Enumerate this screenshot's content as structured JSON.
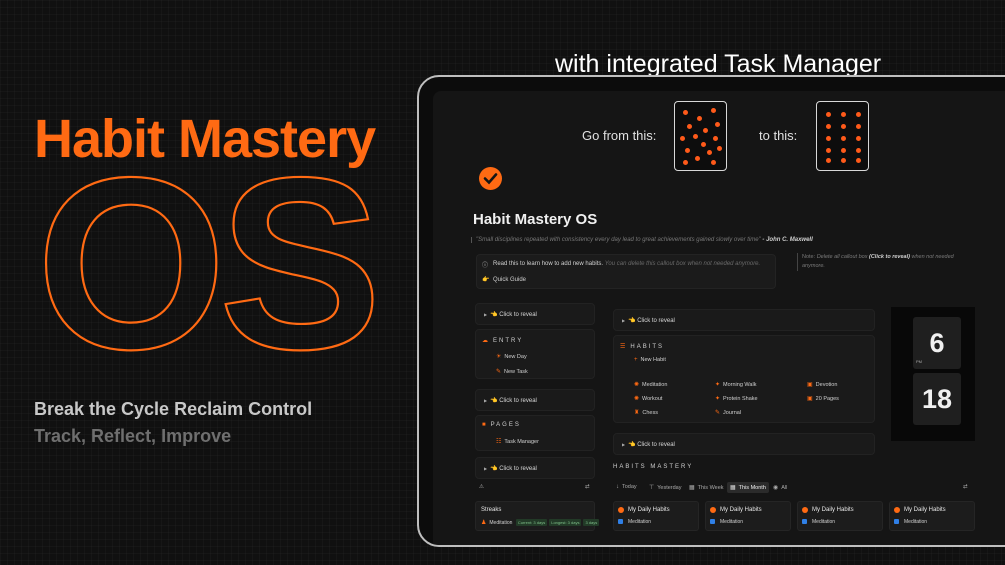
{
  "hero": {
    "title": "Habit Mastery",
    "os": "OS",
    "subtitle": "Break the Cycle Reclaim Control",
    "subtitle2": "Track, Reflect, Improve"
  },
  "tagline": "with integrated Task Manager",
  "comparison": {
    "from_label": "Go from this:",
    "to_label": "to this:"
  },
  "page": {
    "title": "Habit Mastery OS",
    "quote": "\"Small disciplines repeated with consistency every day lead to great achievements gained slowly over time\"",
    "quote_author": "- John C. Maxwell",
    "callout_text": "Read this to learn how to add new habits.",
    "callout_muted": "You can delete this callout box when not needed anymore.",
    "quick_guide": "Quick Guide",
    "note_prefix": "Note:",
    "note_muted1": "Delete all callout box",
    "note_bold": "(Click to reveal)",
    "note_muted2": "when not needed anymore."
  },
  "left_panel": {
    "reveal": "👈 Click to reveal",
    "entry_heading": "ENTRY",
    "entry_items": [
      "New Day",
      "New Task"
    ],
    "pages_heading": "PAGES",
    "pages_items": [
      "Task Manager"
    ]
  },
  "habits": {
    "reveal": "👈 Click to reveal",
    "heading": "HABITS",
    "new_habit": "New Habit",
    "items": [
      "Meditation",
      "Morning Walk",
      "Devotion",
      "Workout",
      "Protein Shake",
      "20 Pages",
      "Chess",
      "Journal"
    ]
  },
  "clock": {
    "hour": "6",
    "minute": "18",
    "period": "PM"
  },
  "mastery": {
    "heading": "HABITS MASTERY",
    "filters": [
      "Today",
      "Yesterday",
      "This Week",
      "This Month",
      "All"
    ],
    "active_filter": "This Month",
    "card_title": "My Daily Habits",
    "card_item": "Meditation"
  },
  "streaks": {
    "title": "Streaks",
    "row_label": "Meditation",
    "tags": [
      "Current: 3 days",
      "Longest: 3 days",
      "3 days"
    ]
  },
  "colors": {
    "accent": "#ff6a13",
    "background": "#101010",
    "screen": "#151515"
  }
}
